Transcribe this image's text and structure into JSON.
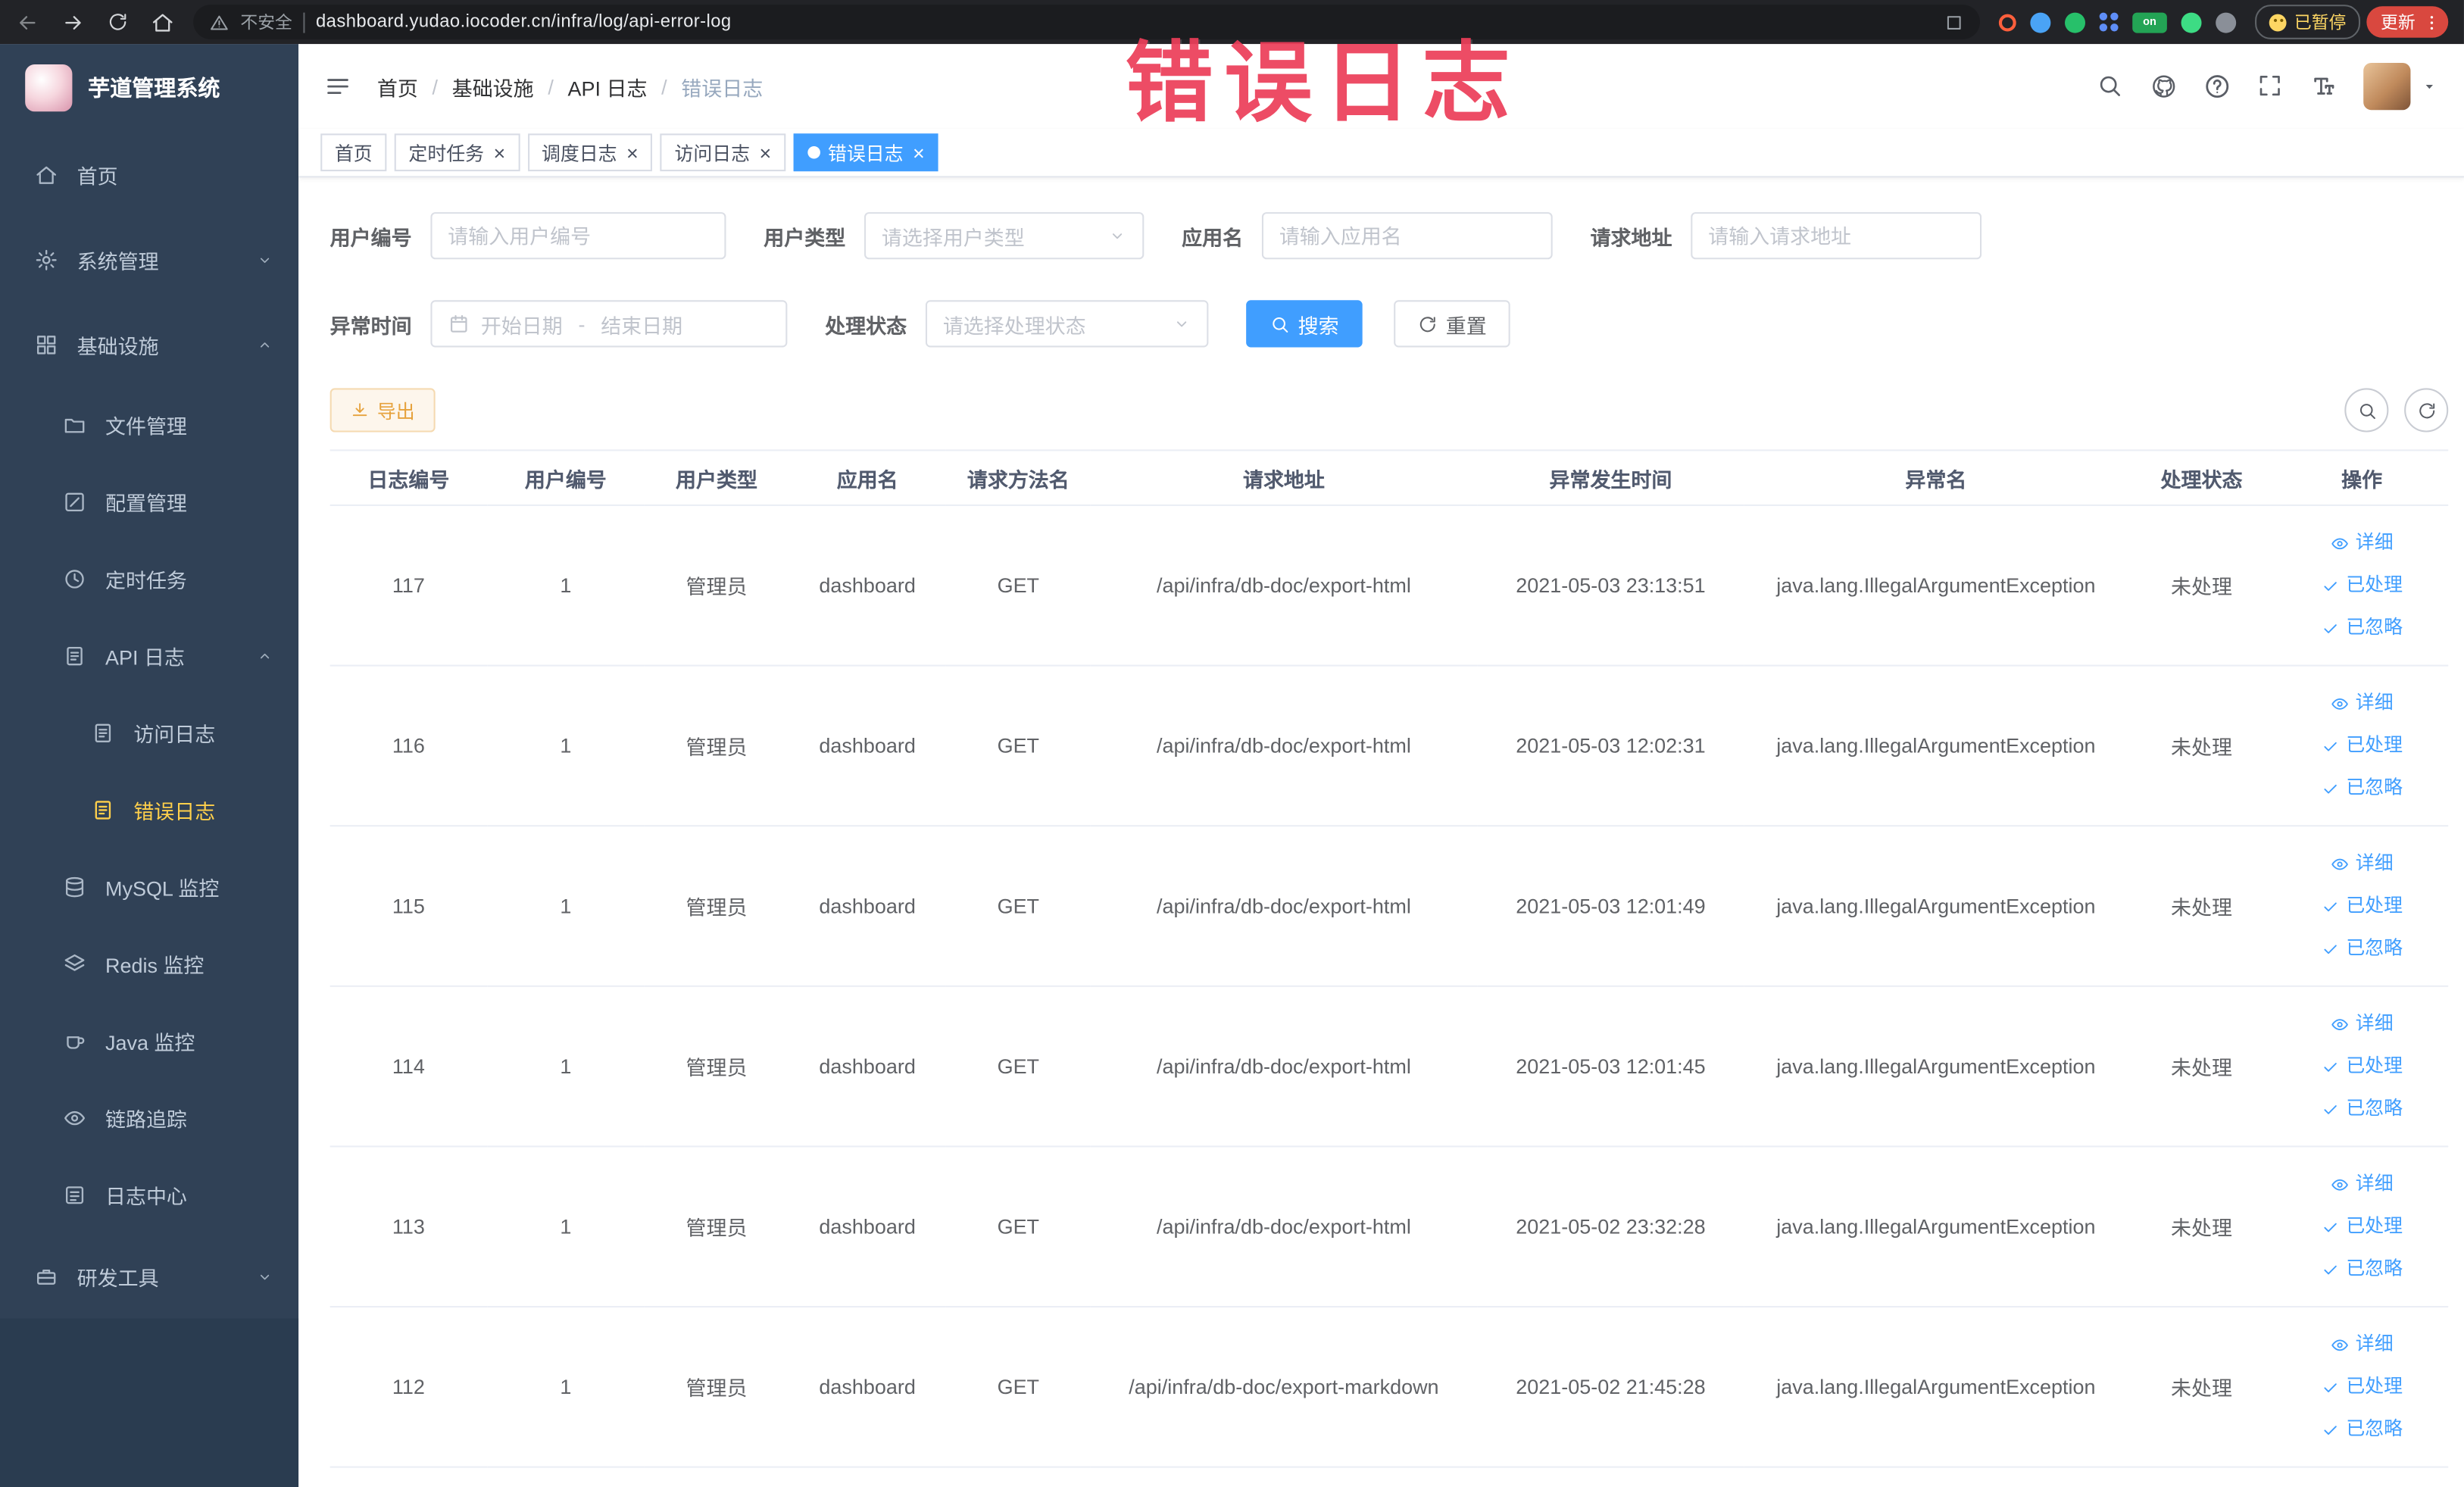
{
  "browser": {
    "security_label": "不安全",
    "url": "dashboard.yudao.iocoder.cn/infra/log/api-error-log",
    "extension_on_badge": "on",
    "paused_badge": "已暂停",
    "update_button": "更新"
  },
  "watermark": "错误日志",
  "sidebar": {
    "logo_title": "芋道管理系统",
    "items": [
      {
        "key": "home",
        "label": "首页",
        "icon": "home-icon",
        "level": 0
      },
      {
        "key": "system",
        "label": "系统管理",
        "icon": "gear-icon",
        "level": 0,
        "expand": "down"
      },
      {
        "key": "infra",
        "label": "基础设施",
        "icon": "grid-icon",
        "level": 0,
        "expand": "up"
      },
      {
        "key": "file",
        "label": "文件管理",
        "icon": "folder-icon",
        "level": 1
      },
      {
        "key": "config",
        "label": "配置管理",
        "icon": "edit-icon",
        "level": 1
      },
      {
        "key": "job",
        "label": "定时任务",
        "icon": "clock-icon",
        "level": 1
      },
      {
        "key": "api-log",
        "label": "API 日志",
        "icon": "doc-icon",
        "level": 1,
        "expand": "up"
      },
      {
        "key": "access-log",
        "label": "访问日志",
        "icon": "doc-icon",
        "level": 2
      },
      {
        "key": "error-log",
        "label": "错误日志",
        "icon": "doc-icon",
        "level": 2,
        "active": true
      },
      {
        "key": "mysql",
        "label": "MySQL 监控",
        "icon": "database-icon",
        "level": 1
      },
      {
        "key": "redis",
        "label": "Redis 监控",
        "icon": "layers-icon",
        "level": 1
      },
      {
        "key": "java",
        "label": "Java 监控",
        "icon": "coffee-icon",
        "level": 1
      },
      {
        "key": "trace",
        "label": "链路追踪",
        "icon": "eye-icon",
        "level": 1
      },
      {
        "key": "log-center",
        "label": "日志中心",
        "icon": "board-icon",
        "level": 1
      },
      {
        "key": "dev-tools",
        "label": "研发工具",
        "icon": "toolbox-icon",
        "level": 0,
        "expand": "down"
      }
    ]
  },
  "breadcrumb": {
    "items": [
      "首页",
      "基础设施",
      "API 日志",
      "错误日志"
    ],
    "separator": "/"
  },
  "tabs": [
    {
      "key": "home",
      "label": "首页",
      "closable": false,
      "active": false
    },
    {
      "key": "job",
      "label": "定时任务",
      "closable": true,
      "active": false
    },
    {
      "key": "job-log",
      "label": "调度日志",
      "closable": true,
      "active": false
    },
    {
      "key": "access-log",
      "label": "访问日志",
      "closable": true,
      "active": false
    },
    {
      "key": "error-log",
      "label": "错误日志",
      "closable": true,
      "active": true
    }
  ],
  "filters": {
    "user_id": {
      "label": "用户编号",
      "placeholder": "请输入用户编号"
    },
    "user_type": {
      "label": "用户类型",
      "placeholder": "请选择用户类型"
    },
    "app_name": {
      "label": "应用名",
      "placeholder": "请输入应用名"
    },
    "request_url": {
      "label": "请求地址",
      "placeholder": "请输入请求地址"
    },
    "exception_time": {
      "label": "异常时间",
      "start_placeholder": "开始日期",
      "separator": "-",
      "end_placeholder": "结束日期"
    },
    "process_status": {
      "label": "处理状态",
      "placeholder": "请选择处理状态"
    },
    "search_button": "搜索",
    "reset_button": "重置"
  },
  "toolbar": {
    "export_button": "导出"
  },
  "table": {
    "columns": [
      "日志编号",
      "用户编号",
      "用户类型",
      "应用名",
      "请求方法名",
      "请求地址",
      "异常发生时间",
      "异常名",
      "处理状态",
      "操作"
    ],
    "actions": [
      "详细",
      "已处理",
      "已忽略"
    ],
    "rows": [
      {
        "id": "117",
        "user_id": "1",
        "user_type": "管理员",
        "app": "dashboard",
        "method": "GET",
        "url": "/api/infra/db-doc/export-html",
        "time": "2021-05-03 23:13:51",
        "exception": "java.lang.IllegalArgumentException",
        "status": "未处理"
      },
      {
        "id": "116",
        "user_id": "1",
        "user_type": "管理员",
        "app": "dashboard",
        "method": "GET",
        "url": "/api/infra/db-doc/export-html",
        "time": "2021-05-03 12:02:31",
        "exception": "java.lang.IllegalArgumentException",
        "status": "未处理"
      },
      {
        "id": "115",
        "user_id": "1",
        "user_type": "管理员",
        "app": "dashboard",
        "method": "GET",
        "url": "/api/infra/db-doc/export-html",
        "time": "2021-05-03 12:01:49",
        "exception": "java.lang.IllegalArgumentException",
        "status": "未处理"
      },
      {
        "id": "114",
        "user_id": "1",
        "user_type": "管理员",
        "app": "dashboard",
        "method": "GET",
        "url": "/api/infra/db-doc/export-html",
        "time": "2021-05-03 12:01:45",
        "exception": "java.lang.IllegalArgumentException",
        "status": "未处理"
      },
      {
        "id": "113",
        "user_id": "1",
        "user_type": "管理员",
        "app": "dashboard",
        "method": "GET",
        "url": "/api/infra/db-doc/export-html",
        "time": "2021-05-02 23:32:28",
        "exception": "java.lang.IllegalArgumentException",
        "status": "未处理"
      },
      {
        "id": "112",
        "user_id": "1",
        "user_type": "管理员",
        "app": "dashboard",
        "method": "GET",
        "url": "/api/infra/db-doc/export-markdown",
        "time": "2021-05-02 21:45:28",
        "exception": "java.lang.IllegalArgumentException",
        "status": "未处理"
      }
    ]
  },
  "colors": {
    "accent": "#409eff",
    "sidebar_bg": "#304156",
    "sidebar_active_text": "#ffd04b",
    "watermark_red": "rgba(235,61,88,0.92)",
    "warning_text": "#e6a23c"
  }
}
